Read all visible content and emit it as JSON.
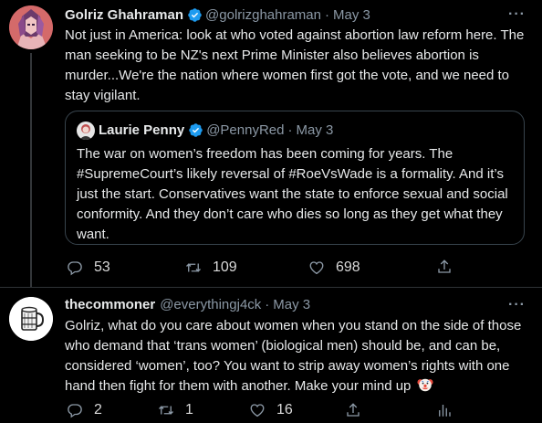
{
  "tweet1": {
    "name": "Golriz Ghahraman",
    "handle": "@golrizghahraman",
    "separator": "·",
    "date": "May 3",
    "more": "···",
    "text": "Not just in America: look at who voted against abortion law reform here. The man seeking to be NZ's next Prime Minister also believes abortion is murder...We're the nation where women first got the vote, and we need to stay vigilant.",
    "quote": {
      "name": "Laurie Penny",
      "handle": "@PennyRed",
      "separator": "·",
      "date": "May 3",
      "text": "The war on women’s freedom has been coming for years. The #SupremeCourt’s likely reversal of #RoeVsWade is a formality. And it’s just the start. Conservatives want  the state to enforce sexual and social conformity. And they don’t care who dies so long as they get what they want."
    },
    "actions": {
      "replies": "53",
      "retweets": "109",
      "likes": "698"
    }
  },
  "tweet2": {
    "name": "thecommoner",
    "handle": "@everythingj4ck",
    "separator": "·",
    "date": "May 3",
    "more": "···",
    "text": "Golriz, what do you care about women when you stand on the side of those who demand that ‘trans women’ (biological men) should be, and can be, considered ‘women’, too? You want to strip away women’s rights with one hand then fight for them with another. Make your mind up",
    "emoji": "clown-face-emoji",
    "actions": {
      "replies": "2",
      "retweets": "1",
      "likes": "16"
    }
  },
  "colors": {
    "background": "#000000",
    "text": "#e7e9ea",
    "secondary": "#8b98a5",
    "verified": "#1d9bf0",
    "border": "#38444d"
  },
  "icons": [
    "verified-badge-icon",
    "more-icon",
    "reply-icon",
    "retweet-icon",
    "like-icon",
    "share-icon",
    "analytics-icon"
  ]
}
